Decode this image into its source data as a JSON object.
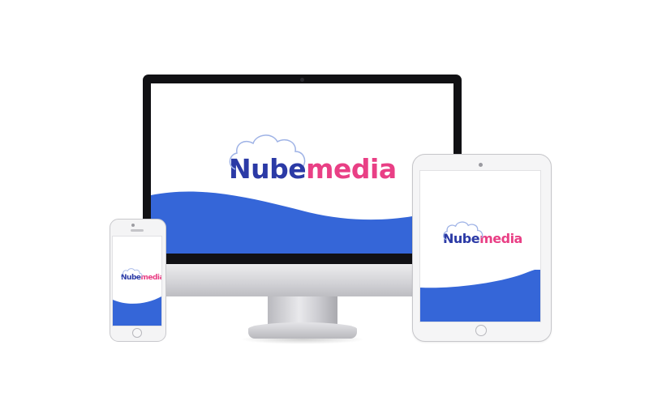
{
  "brand": {
    "part1": "Nube",
    "part2": "media"
  },
  "colors": {
    "primary_blue": "#3566d8",
    "logo_blue": "#2b3aa6",
    "logo_pink": "#e93f85",
    "cloud_outline": "#9fb3e6"
  }
}
